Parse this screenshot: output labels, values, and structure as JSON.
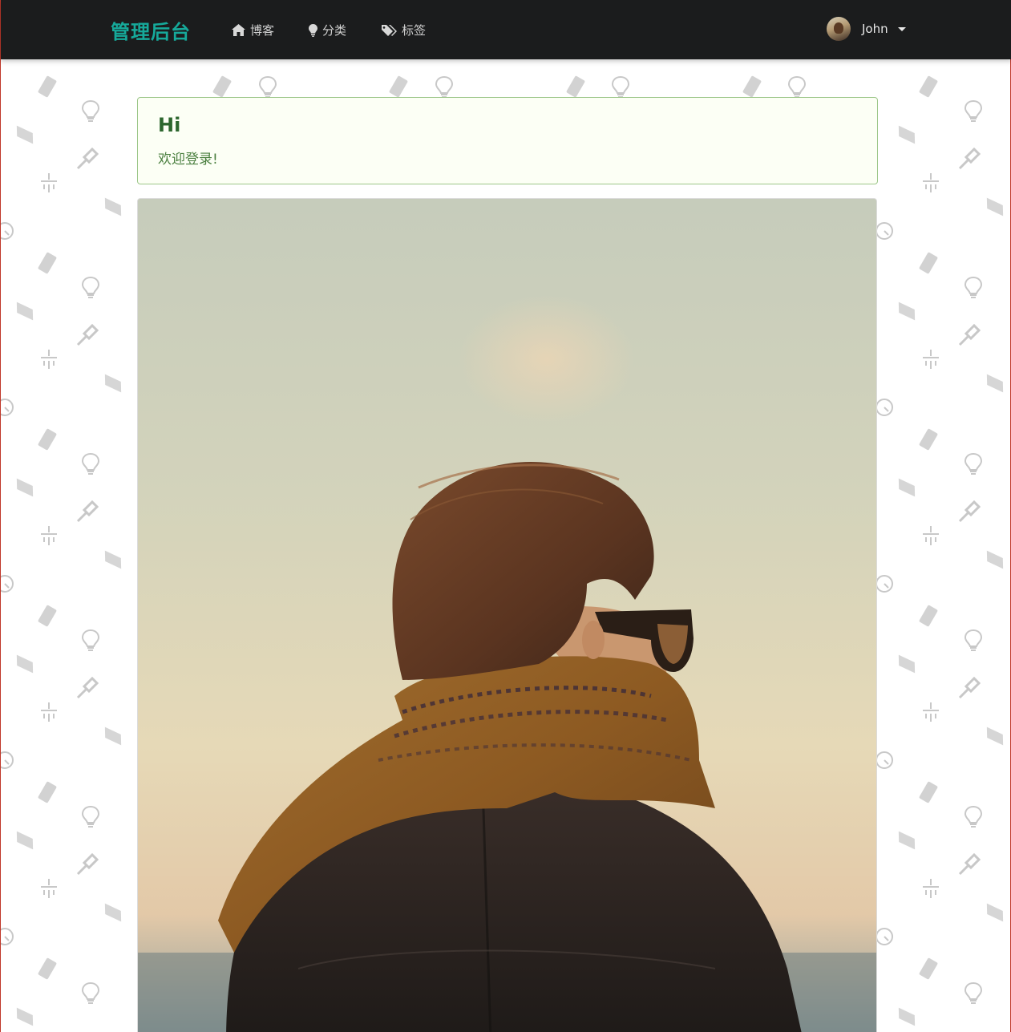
{
  "navbar": {
    "brand": "管理后台",
    "items": [
      {
        "label": "博客",
        "icon": "home-icon"
      },
      {
        "label": "分类",
        "icon": "lightbulb-icon"
      },
      {
        "label": "标签",
        "icon": "tags-icon"
      }
    ],
    "user": {
      "name": "John",
      "icon": "avatar"
    }
  },
  "message": {
    "header": "Hi",
    "text": "欢迎登录!"
  },
  "colors": {
    "navbar_bg": "#1b1c1d",
    "brand": "#16a99a",
    "message_bg": "#fcfff5",
    "message_border": "#9dc78a",
    "message_text": "#2c662d"
  }
}
